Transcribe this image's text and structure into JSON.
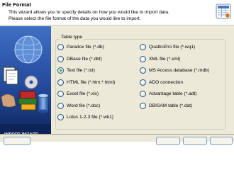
{
  "header": {
    "title": "File Format",
    "line1": "This wizard allows you to specify details on how you would like to import data.",
    "line2": "Please select the file format of the data you would like to import."
  },
  "banner": {
    "label": "IMPORT WIZARD"
  },
  "group": {
    "legend": "Table type"
  },
  "options_left": [
    {
      "label": "Paradox file (*.db)",
      "checked": false
    },
    {
      "label": "DBase file (*.dbf)",
      "checked": false
    },
    {
      "label": "Text file (*.txt)",
      "checked": true
    },
    {
      "label": "HTML file (*.htm;*.html)",
      "checked": false
    },
    {
      "label": "Excel file (*.xls)",
      "checked": false
    },
    {
      "label": "Word file (*.doc)",
      "checked": false
    },
    {
      "label": "Lotus 1-2-3 file (*.wk1)",
      "checked": false
    }
  ],
  "options_right": [
    {
      "label": "QuattroPro file (*.wq1)",
      "checked": false
    },
    {
      "label": "XML file (*.xml)",
      "checked": false
    },
    {
      "label": "MS Access database (*.mdb)",
      "checked": false
    },
    {
      "label": "ADO connection",
      "checked": false
    },
    {
      "label": "Advantage table (*.adt)",
      "checked": false
    },
    {
      "label": "DBISAM table (*.dat)",
      "checked": false
    }
  ],
  "colors": {
    "radio_dot": "#21a121",
    "radio_border": "#1c5180",
    "dialog_bg": "#ece9d8"
  }
}
